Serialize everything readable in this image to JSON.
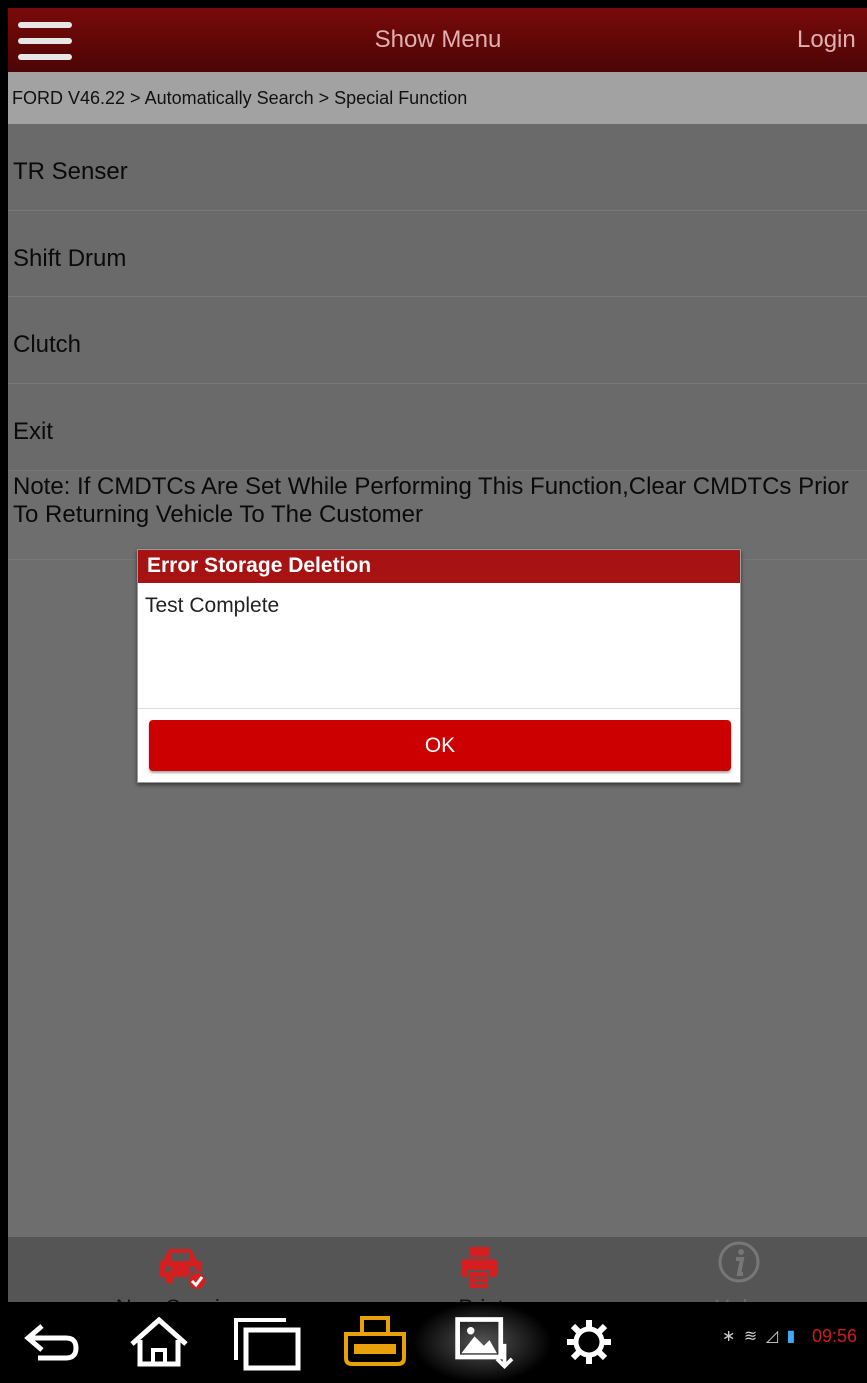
{
  "header": {
    "title": "Show Menu",
    "login": "Login"
  },
  "breadcrumb": "FORD V46.22 > Automatically Search > Special Function",
  "menu_items": [
    {
      "label": "TR Senser"
    },
    {
      "label": "Shift Drum"
    },
    {
      "label": "Clutch"
    },
    {
      "label": "Exit"
    }
  ],
  "note": "Note: If CMDTCs Are Set While Performing This Function,Clear CMDTCs Prior To Returning Vehicle To The Customer",
  "dialog": {
    "title": "Error Storage Deletion",
    "message": "Test Complete",
    "ok_label": "OK"
  },
  "toolbar": {
    "new_session": "New Session",
    "print": "Print",
    "help": "Help"
  },
  "system_bar": {
    "time": "09:56"
  },
  "colors": {
    "header": "#6b0808",
    "accent": "#cc0000",
    "icon_red": "#d31f1f",
    "orange_icon": "#e8a00b"
  },
  "icons": [
    "menu-icon",
    "car-icon",
    "printer-icon",
    "help-icon",
    "back-icon",
    "home-icon",
    "recent-apps-icon",
    "obd-icon",
    "screenshot-icon",
    "settings-icon"
  ]
}
